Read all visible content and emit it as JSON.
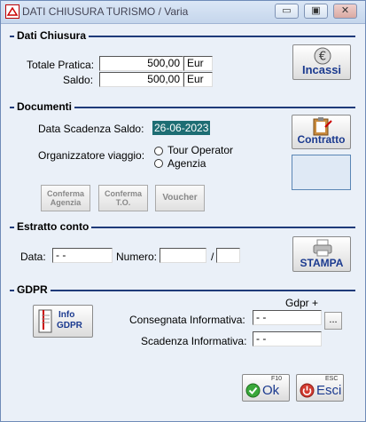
{
  "window": {
    "title": "DATI CHIUSURA TURISMO / Varia",
    "min_label": "▭",
    "max_label": "▣",
    "close_label": "✕"
  },
  "sections": {
    "dati_chiusura": "Dati Chiusura",
    "documenti": "Documenti",
    "estratto_conto": "Estratto conto",
    "gdpr": "GDPR"
  },
  "dati_chiusura": {
    "totale_label": "Totale Pratica:",
    "totale_value": "500,00",
    "totale_currency": "Eur",
    "saldo_label": "Saldo:",
    "saldo_value": "500,00",
    "saldo_currency": "Eur",
    "incassi_label": "Incassi"
  },
  "documenti": {
    "scadenza_label": "Data Scadenza Saldo:",
    "scadenza_value": "26-06-2023",
    "organizzatore_label": "Organizzatore viaggio:",
    "options": [
      "Tour Operator",
      "Agenzia"
    ],
    "contratto_label": "Contratto",
    "conferma_agenzia_l1": "Conferma",
    "conferma_agenzia_l2": "Agenzia",
    "conferma_to_l1": "Conferma",
    "conferma_to_l2": "T.O.",
    "voucher_label": "Voucher"
  },
  "estratto_conto": {
    "data_label": "Data:",
    "data_value": "- -",
    "numero_label": "Numero:",
    "numero_value": "",
    "slash": "/",
    "suffix_value": "",
    "stampa_label": "STAMPA"
  },
  "gdpr": {
    "info_l1": "Info",
    "info_l2": "GDPR",
    "gdpr_plus": "Gdpr +",
    "consegnata_label": "Consegnata Informativa:",
    "consegnata_value": "- -",
    "browse_label": "...",
    "scadenza_label": "Scadenza Informativa:",
    "scadenza_value": "- -"
  },
  "footer": {
    "ok_label": "Ok",
    "ok_key": "F10",
    "esci_label": "Esci",
    "esci_key": "ESC"
  },
  "icons": [
    "app-icon",
    "euro-icon",
    "clipboard-icon",
    "printer-icon",
    "document-icon",
    "check-icon",
    "power-icon"
  ],
  "colors": {
    "accent": "#1f3b7a",
    "date_highlight": "#1d6d73",
    "button_text": "#1b3a8f"
  }
}
